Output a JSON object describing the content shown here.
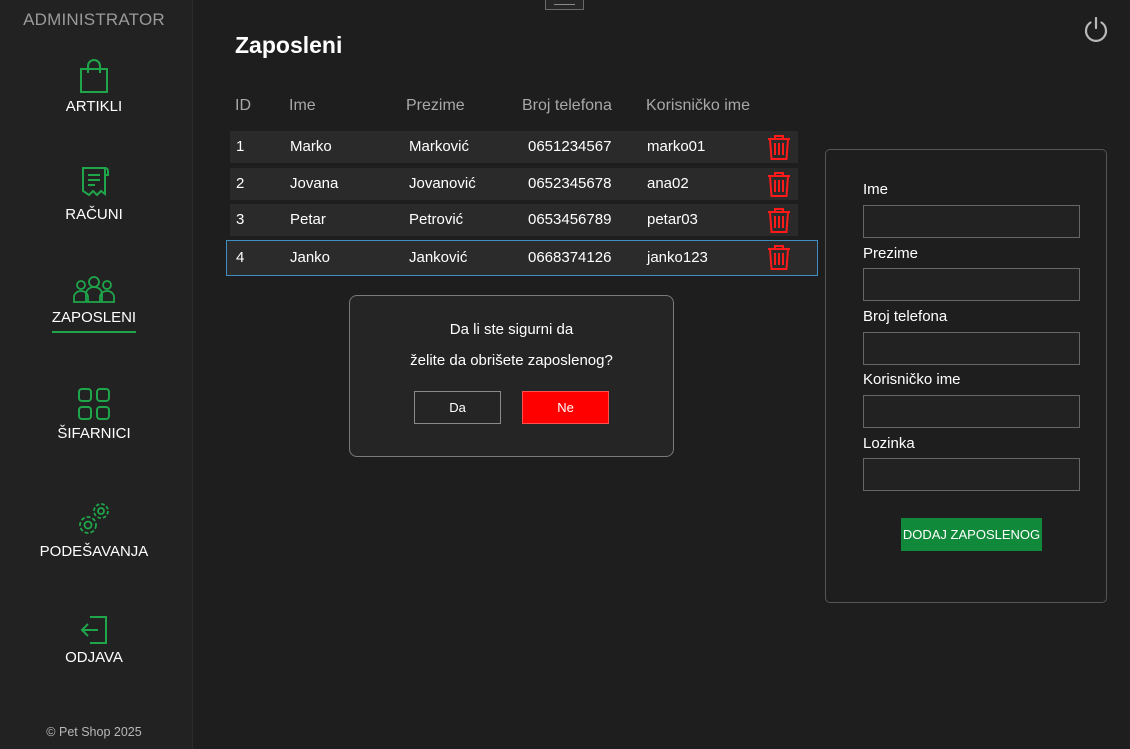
{
  "sidebar": {
    "role": "ADMINISTRATOR",
    "items": [
      {
        "label": "ARTIKLI",
        "icon": "shopping-bag-icon"
      },
      {
        "label": "RAČUNI",
        "icon": "receipt-icon"
      },
      {
        "label": "ZAPOSLENI",
        "icon": "users-icon",
        "active": true
      },
      {
        "label": "ŠIFARNICI",
        "icon": "grid-icon"
      },
      {
        "label": "PODEŠAVANJA",
        "icon": "gears-icon"
      },
      {
        "label": "ODJAVA",
        "icon": "logout-icon"
      }
    ],
    "copyright": "© Pet Shop 2025"
  },
  "page": {
    "title": "Zaposleni"
  },
  "table": {
    "headers": [
      "ID",
      "Ime",
      "Prezime",
      "Broj telefona",
      "Korisničko ime"
    ],
    "rows": [
      [
        "1",
        "Marko",
        "Marković",
        "0651234567",
        "marko01"
      ],
      [
        "2",
        "Jovana",
        "Jovanović",
        "0652345678",
        "ana02"
      ],
      [
        "3",
        "Petar",
        "Petrović",
        "0653456789",
        "petar03"
      ],
      [
        "4",
        "Janko",
        "Janković",
        "0668374126",
        "janko123"
      ]
    ],
    "selected_row": 4
  },
  "dialog": {
    "line1": "Da li ste sigurni da",
    "line2": "želite da obrišete zaposlenog?",
    "yes_label": "Da",
    "no_label": "Ne"
  },
  "form": {
    "fields": [
      {
        "label": "Ime",
        "value": ""
      },
      {
        "label": "Prezime",
        "value": ""
      },
      {
        "label": "Broj telefona",
        "value": ""
      },
      {
        "label": "Korisničko ime",
        "value": ""
      },
      {
        "label": "Lozinka",
        "value": ""
      }
    ],
    "submit_label": "DODAJ ZAPOSLENOG"
  },
  "colors": {
    "accent_green": "#1fa54a",
    "button_green": "#108a3a",
    "danger_red": "#ff0000",
    "selection_blue": "#3f8fc2",
    "background": "#1e1e1e"
  }
}
